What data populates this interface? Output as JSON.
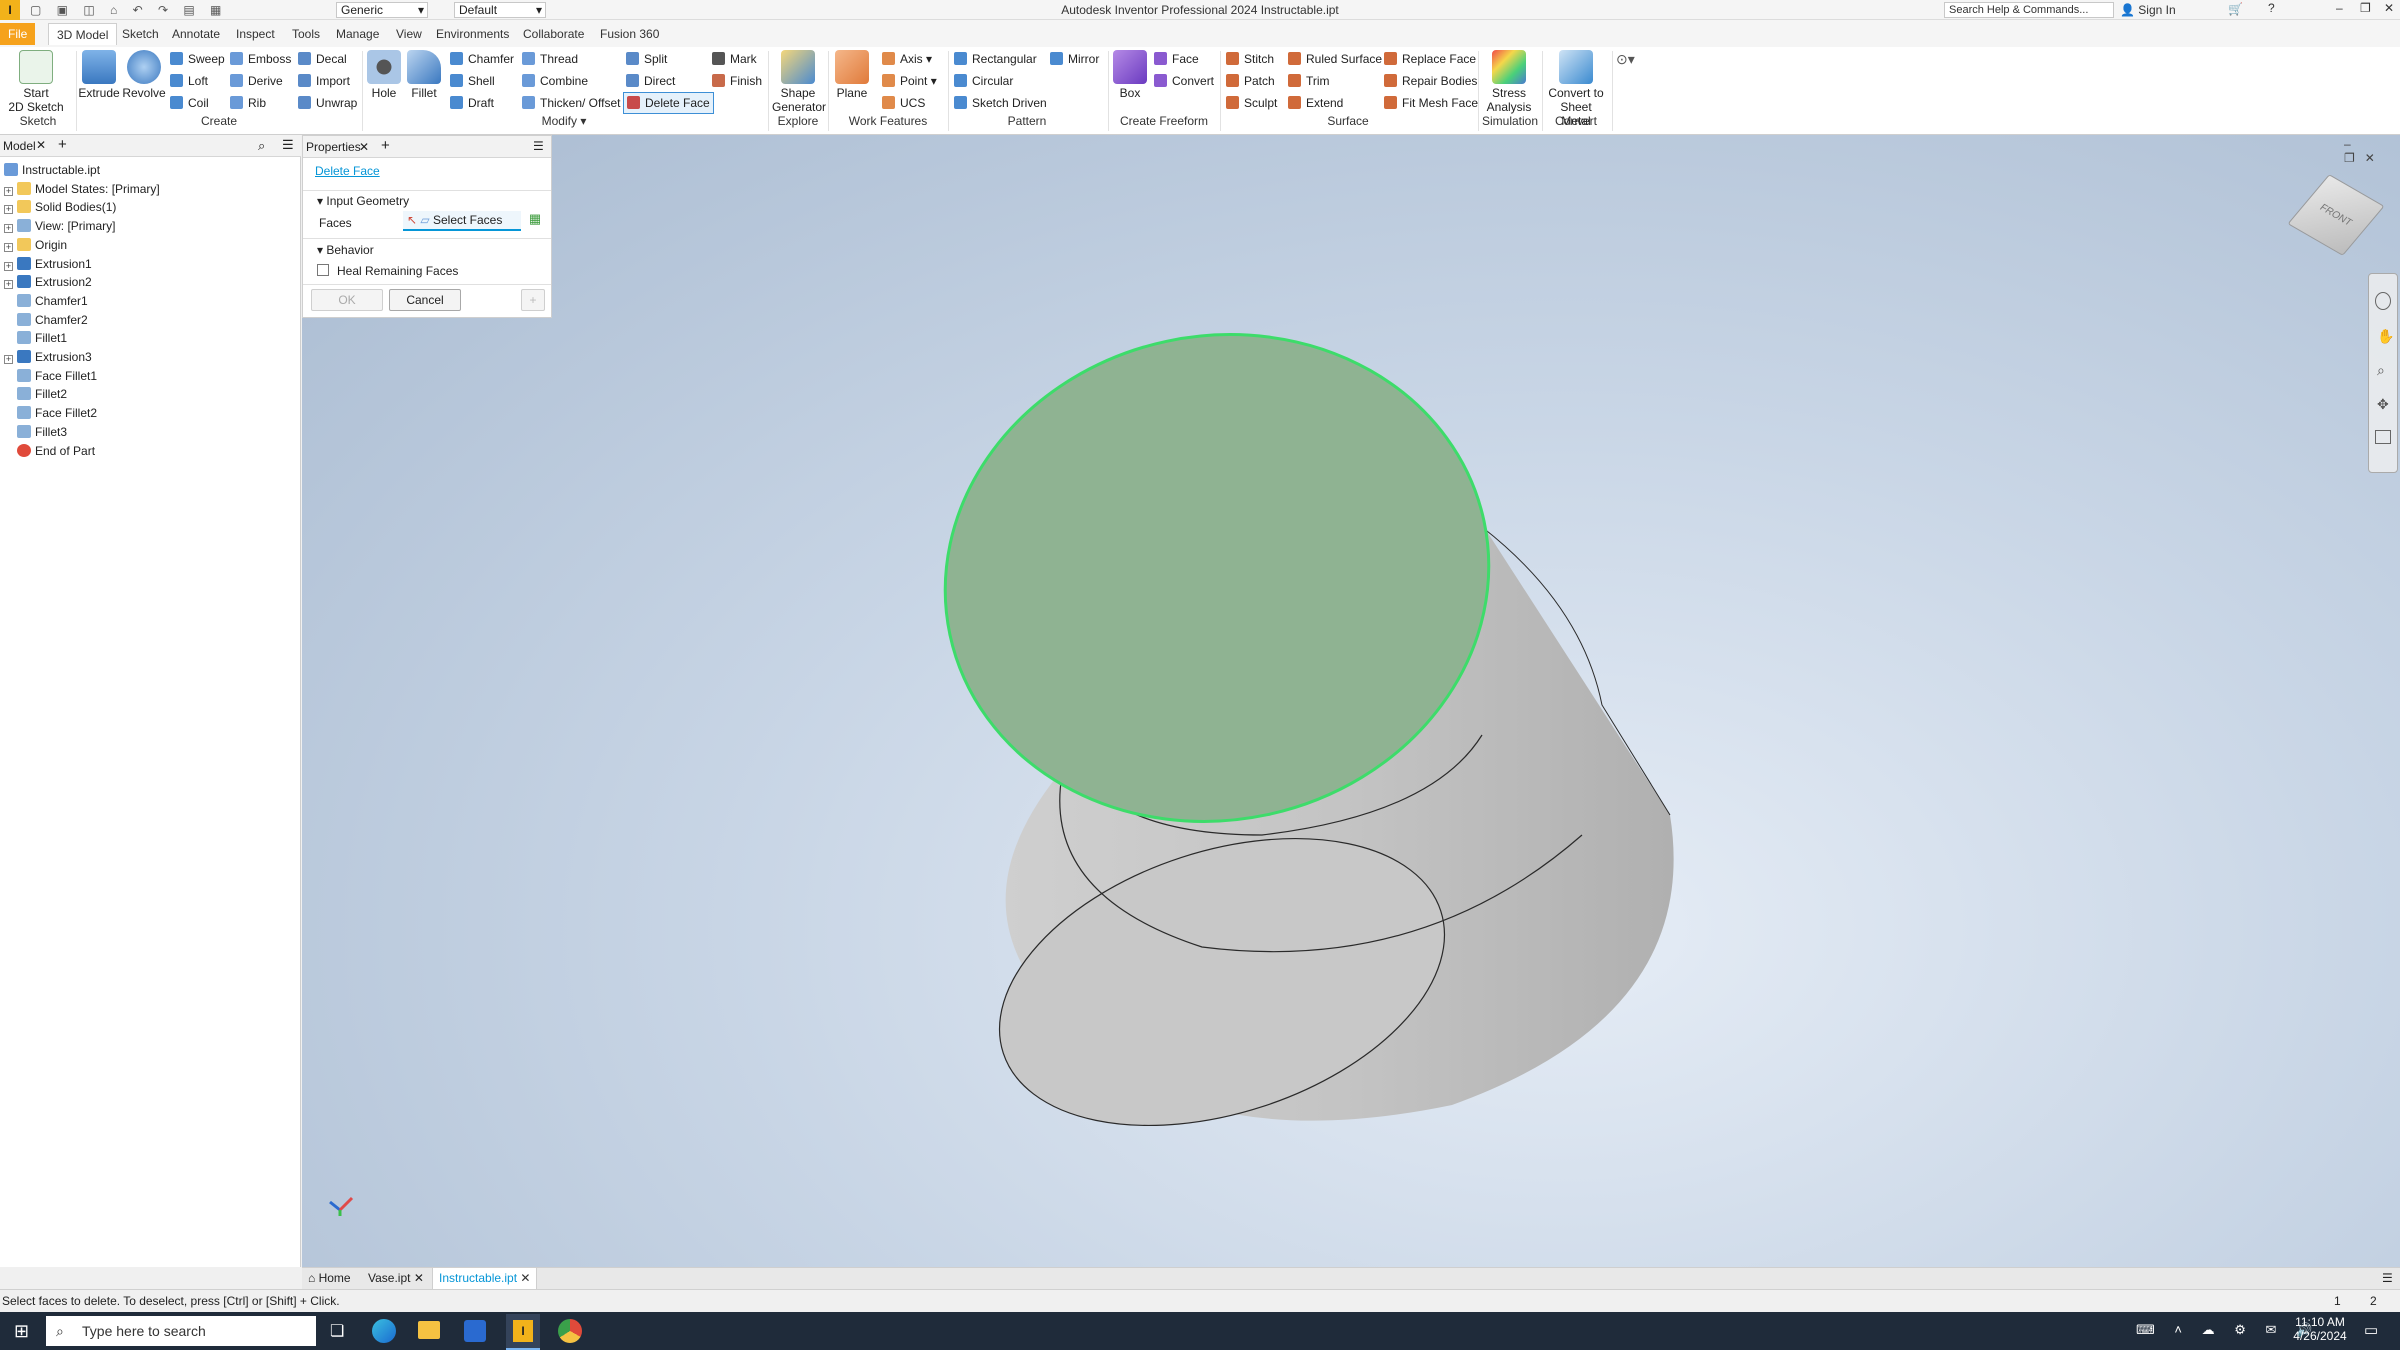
{
  "app": {
    "title": "Autodesk Inventor Professional 2024   Instructable.ipt",
    "appearance_value": "Generic",
    "material_value": "Default",
    "search_placeholder": "Search Help & Commands...",
    "sign_in": "Sign In"
  },
  "tabs": [
    "File",
    "3D Model",
    "Sketch",
    "Annotate",
    "Inspect",
    "Tools",
    "Manage",
    "View",
    "Environments",
    "Collaborate",
    "Fusion 360"
  ],
  "ribbon": {
    "sketch": {
      "start": "Start",
      "sketch2d": "2D Sketch",
      "group": "Sketch"
    },
    "create": {
      "extrude": "Extrude",
      "revolve": "Revolve",
      "sweep": "Sweep",
      "emboss": "Emboss",
      "decal": "Decal",
      "loft": "Loft",
      "derive": "Derive",
      "import": "Import",
      "coil": "Coil",
      "rib": "Rib",
      "unwrap": "Unwrap",
      "group": "Create"
    },
    "modify": {
      "hole": "Hole",
      "fillet": "Fillet",
      "chamfer": "Chamfer",
      "thread": "Thread",
      "split": "Split",
      "mark": "Mark",
      "shell": "Shell",
      "combine": "Combine",
      "direct": "Direct",
      "finish": "Finish",
      "draft": "Draft",
      "thicken": "Thicken/ Offset",
      "delete_face": "Delete Face",
      "group": "Modify"
    },
    "explore": {
      "shape1": "Shape",
      "shape2": "Generator",
      "group": "Explore"
    },
    "work": {
      "plane": "Plane",
      "axis": "Axis",
      "point": "Point",
      "ucs": "UCS",
      "group": "Work Features"
    },
    "pattern": {
      "rectangular": "Rectangular",
      "mirror": "Mirror",
      "circular": "Circular",
      "sketch_driven": "Sketch Driven",
      "group": "Pattern"
    },
    "freeform": {
      "box": "Box",
      "face": "Face",
      "convert": "Convert",
      "group": "Create Freeform"
    },
    "surface": {
      "stitch": "Stitch",
      "ruled": "Ruled Surface",
      "replace": "Replace Face",
      "patch": "Patch",
      "trim": "Trim",
      "repair": "Repair Bodies",
      "sculpt": "Sculpt",
      "extend": "Extend",
      "fitmesh": "Fit Mesh Face",
      "group": "Surface"
    },
    "simulation": {
      "stress1": "Stress",
      "stress2": "Analysis",
      "group": "Simulation"
    },
    "convert": {
      "c1": "Convert to",
      "c2": "Sheet Metal",
      "group": "Convert"
    }
  },
  "browser": {
    "tab": "Model",
    "items": [
      {
        "label": "Instructable.ipt",
        "icon": "part-icon",
        "expand": false,
        "indent": 0
      },
      {
        "label": "Model States: [Primary]",
        "icon": "folder-icon",
        "expand": true,
        "indent": 1
      },
      {
        "label": "Solid Bodies(1)",
        "icon": "folder-icon",
        "expand": true,
        "indent": 1
      },
      {
        "label": "View: [Primary]",
        "icon": "view-icon",
        "expand": true,
        "indent": 1
      },
      {
        "label": "Origin",
        "icon": "folder-icon",
        "expand": true,
        "indent": 1
      },
      {
        "label": "Extrusion1",
        "icon": "extrude-icon",
        "expand": true,
        "indent": 1
      },
      {
        "label": "Extrusion2",
        "icon": "extrude-icon",
        "expand": true,
        "indent": 1
      },
      {
        "label": "Chamfer1",
        "icon": "chamfer-icon",
        "expand": false,
        "indent": 1
      },
      {
        "label": "Chamfer2",
        "icon": "chamfer-icon",
        "expand": false,
        "indent": 1
      },
      {
        "label": "Fillet1",
        "icon": "fillet-icon",
        "expand": false,
        "indent": 1
      },
      {
        "label": "Extrusion3",
        "icon": "extrude-icon",
        "expand": true,
        "indent": 1
      },
      {
        "label": "Face Fillet1",
        "icon": "face-fillet-icon",
        "expand": false,
        "indent": 1
      },
      {
        "label": "Fillet2",
        "icon": "fillet-icon",
        "expand": false,
        "indent": 1
      },
      {
        "label": "Face Fillet2",
        "icon": "face-fillet-icon",
        "expand": false,
        "indent": 1
      },
      {
        "label": "Fillet3",
        "icon": "fillet-icon",
        "expand": false,
        "indent": 1
      },
      {
        "label": "End of Part",
        "icon": "end-of-part-icon",
        "expand": false,
        "indent": 1
      }
    ]
  },
  "properties": {
    "tab": "Properties",
    "command": "Delete Face",
    "input_geometry": "Input Geometry",
    "faces_label": "Faces",
    "select_faces": "Select Faces",
    "behavior": "Behavior",
    "heal": "Heal Remaining Faces",
    "ok": "OK",
    "cancel": "Cancel"
  },
  "viewcube": {
    "face": "FRONT"
  },
  "doc_tabs": [
    {
      "label": "Home"
    },
    {
      "label": "Vase.ipt"
    },
    {
      "label": "Instructable.ipt"
    }
  ],
  "status": {
    "prompt": "Select faces to delete. To deselect, press [Ctrl] or [Shift] + Click.",
    "n1": "1",
    "n2": "2"
  },
  "taskbar": {
    "search_placeholder": "Type here to search",
    "time": "11:10 AM",
    "date": "4/26/2024"
  },
  "colors": {
    "accent": "#0696d7",
    "file_tab": "#f6a21c",
    "selection": "#3ddc6a"
  }
}
